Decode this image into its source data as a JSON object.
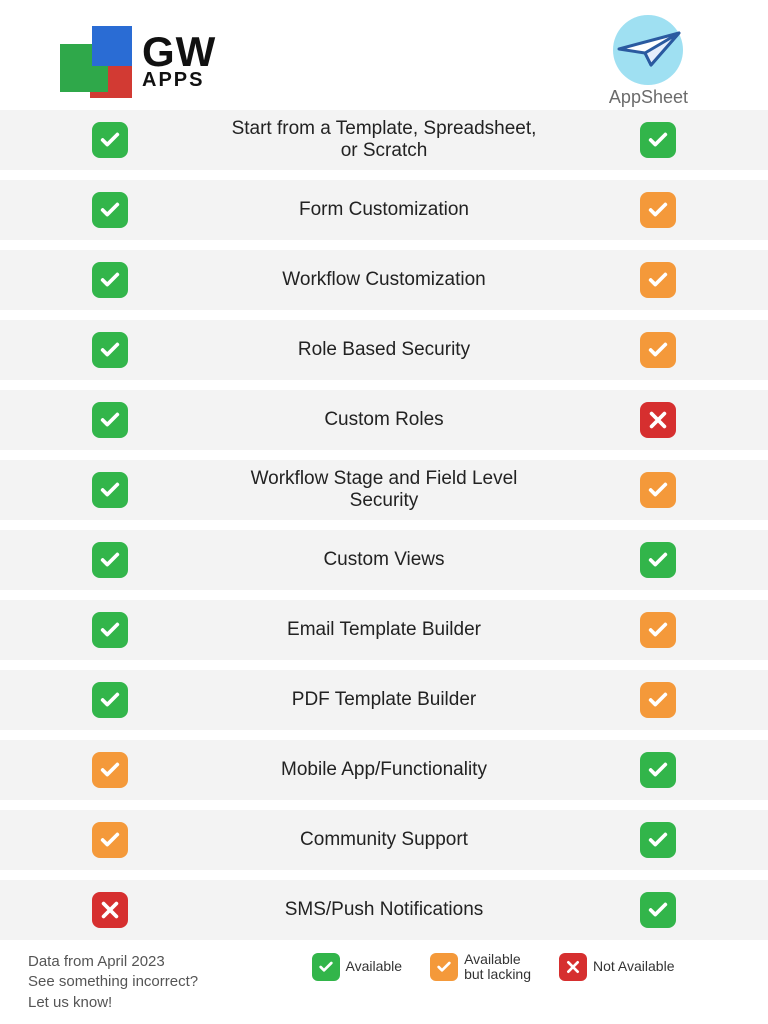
{
  "header": {
    "gwapps_name_top": "GW",
    "gwapps_name_bottom": "APPS",
    "appsheet_name": "AppSheet"
  },
  "rows": [
    {
      "feature": "Start from a Template, Spreadsheet, or Scratch",
      "gw": "available",
      "as": "available"
    },
    {
      "feature": "Form Customization",
      "gw": "available",
      "as": "partial"
    },
    {
      "feature": "Workflow Customization",
      "gw": "available",
      "as": "partial"
    },
    {
      "feature": "Role Based Security",
      "gw": "available",
      "as": "partial"
    },
    {
      "feature": "Custom Roles",
      "gw": "available",
      "as": "not"
    },
    {
      "feature": "Workflow Stage and Field Level Security",
      "gw": "available",
      "as": "partial"
    },
    {
      "feature": "Custom Views",
      "gw": "available",
      "as": "available"
    },
    {
      "feature": "Email Template Builder",
      "gw": "available",
      "as": "partial"
    },
    {
      "feature": "PDF Template Builder",
      "gw": "available",
      "as": "partial"
    },
    {
      "feature": "Mobile App/Functionality",
      "gw": "partial",
      "as": "available"
    },
    {
      "feature": "Community Support",
      "gw": "partial",
      "as": "available"
    },
    {
      "feature": "SMS/Push Notifications",
      "gw": "not",
      "as": "available"
    }
  ],
  "footer": {
    "line1": "Data from April 2023",
    "line2": "See something incorrect?",
    "line3": "Let us know!"
  },
  "legend": {
    "available": "Available",
    "partial_line1": "Available",
    "partial_line2": "but lacking",
    "not": "Not Available"
  },
  "colors": {
    "available": "#32b54a",
    "partial": "#f4993a",
    "not": "#d62f2f"
  }
}
